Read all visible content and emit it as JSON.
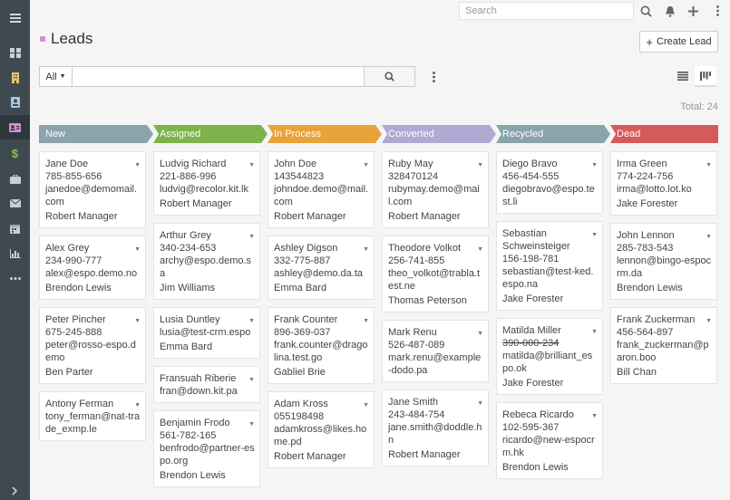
{
  "search": {
    "placeholder": "Search"
  },
  "header": {
    "title": "Leads",
    "create_label": "Create Lead"
  },
  "filter": {
    "all_label": "All"
  },
  "total": "Total: 24",
  "colors": {
    "nav_bg": "#3e4a50",
    "title_square": "#d98ed4"
  },
  "nav_icons": [
    "menu-icon",
    "dashboard-icon",
    "building-icon",
    "contact-card-icon",
    "lead-card-icon",
    "dollar-icon",
    "briefcase-icon",
    "envelope-icon",
    "calendar-icon",
    "chart-icon",
    "more-icon"
  ],
  "columns": [
    {
      "label": "New",
      "color": "#8aa3ad",
      "cards": [
        {
          "name": "Jane Doe",
          "phone": "785-855-656",
          "email": "janedoe@demomail.com",
          "owner": "Robert Manager"
        },
        {
          "name": "Alex Grey",
          "phone": "234-990-777",
          "email": "alex@espo.demo.no",
          "owner": "Brendon Lewis"
        },
        {
          "name": "Peter Pincher",
          "phone": "675-245-888",
          "email": "peter@rosso-espo.demo",
          "owner": "Ben Parter"
        },
        {
          "name": "Antony Ferman",
          "phone": "",
          "email": "tony_ferman@nat-trade_exmp.le",
          "owner": ""
        }
      ]
    },
    {
      "label": "Assigned",
      "color": "#7eb24a",
      "cards": [
        {
          "name": "Ludvig Richard",
          "phone": "221-886-996",
          "email": "ludvig@recolor.kit.lk",
          "owner": "Robert Manager"
        },
        {
          "name": "Arthur Grey",
          "phone": "340-234-653",
          "email": "archy@espo.demo.sa",
          "owner": "Jim Williams"
        },
        {
          "name": "Lusia Duntley",
          "phone": "",
          "email": "lusia@test-crm.espo",
          "owner": "Emma Bard"
        },
        {
          "name": "Fransuah Riberie",
          "phone": "",
          "email": "fran@down.kit.pa",
          "owner": ""
        },
        {
          "name": "Benjamin Frodo",
          "phone": "561-782-165",
          "email": "benfrodo@partner-espo.org",
          "owner": "Brendon Lewis"
        }
      ]
    },
    {
      "label": "In Process",
      "color": "#e8a23a",
      "cards": [
        {
          "name": "John Doe",
          "phone": "143544823",
          "email": "johndoe.demo@mail.com",
          "owner": "Robert Manager"
        },
        {
          "name": "Ashley Digson",
          "phone": "332-775-887",
          "email": "ashley@demo.da.ta",
          "owner": "Emma Bard"
        },
        {
          "name": "Frank Counter",
          "phone": "896-369-037",
          "email": "frank.counter@dragolina.test.go",
          "owner": "Gabliel Brie"
        },
        {
          "name": "Adam Kross",
          "phone": "055198498",
          "email": "adamkross@likes.home.pd",
          "owner": "Robert Manager"
        }
      ]
    },
    {
      "label": "Converted",
      "color": "#b1a9d3",
      "cards": [
        {
          "name": "Ruby May",
          "phone": "328470124",
          "email": "rubymay.demo@mail.com",
          "owner": "Robert Manager"
        },
        {
          "name": "Theodore Volkot",
          "phone": "256-741-855",
          "email": "theo_volkot@trabla.test.ne",
          "owner": "Thomas Peterson"
        },
        {
          "name": "Mark Renu",
          "phone": "526-487-089",
          "email": "mark.renu@example-dodo.pa",
          "owner": ""
        },
        {
          "name": "Jane Smith",
          "phone": "243-484-754",
          "email": "jane.smith@doddle.hn",
          "owner": "Robert Manager"
        }
      ]
    },
    {
      "label": "Recycled",
      "color": "#8aa3ad",
      "cards": [
        {
          "name": "Diego Bravo",
          "phone": "456-454-555",
          "email": "diegobravo@espo.test.li",
          "owner": ""
        },
        {
          "name": "Sebastian Schweinsteiger",
          "phone": "156-198-781",
          "email": "sebastian@test-ked.espo.na",
          "owner": "Jake Forester"
        },
        {
          "name": "Matilda Miller",
          "phone": "390-000-234",
          "email": "matilda@brilliant_espo.ok",
          "owner": "Jake Forester",
          "phone_struck": true
        },
        {
          "name": "Rebeca Ricardo",
          "phone": "102-595-367",
          "email": "ricardo@new-espocrm.hk",
          "owner": "Brendon Lewis"
        }
      ]
    },
    {
      "label": "Dead",
      "color": "#d55b5b",
      "cards": [
        {
          "name": "Irma Green",
          "phone": "774-224-756",
          "email": "irma@lotto.lot.ko",
          "owner": "Jake Forester"
        },
        {
          "name": "John Lennon",
          "phone": "285-783-543",
          "email": "lennon@bingo-espocrm.da",
          "owner": "Brendon Lewis"
        },
        {
          "name": "Frank Zuckerman",
          "phone": "456-564-897",
          "email": "frank_zuckerman@paron.boo",
          "owner": "Bill Chan"
        }
      ]
    }
  ]
}
